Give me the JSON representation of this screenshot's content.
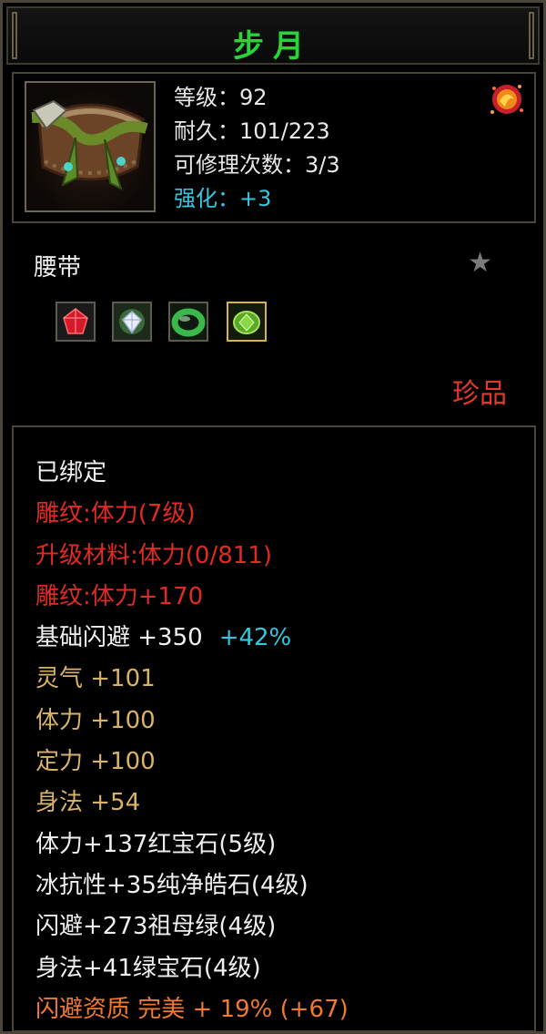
{
  "title": "步月",
  "stats": {
    "level": "等级：92",
    "durability": "耐久：101/223",
    "repairs": "可修理次数：3/3",
    "enhance": "强化：+3"
  },
  "item_type": "腰带",
  "quality": "珍品",
  "gems": [
    "ruby-gem",
    "diamond-gem",
    "jade-ring-gem",
    "emerald-gem"
  ],
  "attributes": [
    {
      "text": "已绑定",
      "color": "#f0f0f0"
    },
    {
      "text": "雕纹:体力(7级)",
      "color": "#e02a22"
    },
    {
      "text": "升级材料:体力(0/811)",
      "color": "#e02a22"
    },
    {
      "text": "雕纹:体力+170",
      "color": "#e02a22"
    },
    {
      "text": "基础闪避 +350",
      "extra": "+42%",
      "color": "#f0f0f0"
    },
    {
      "text": "灵气 +101",
      "color": "#d8b268"
    },
    {
      "text": "体力 +100",
      "color": "#d8b268"
    },
    {
      "text": "定力 +100",
      "color": "#d8b268"
    },
    {
      "text": "身法 +54",
      "color": "#d8b268"
    },
    {
      "text": "体力+137红宝石(5级)",
      "color": "#f0f0f0"
    },
    {
      "text": "冰抗性+35纯净皓石(4级)",
      "color": "#f0f0f0"
    },
    {
      "text": "闪避+273祖母绿(4级)",
      "color": "#f0f0f0"
    },
    {
      "text": "身法+41绿宝石(4级)",
      "color": "#f0f0f0"
    },
    {
      "text": "闪避资质 完美 + 19% (+67)",
      "color": "#f07a30"
    }
  ]
}
